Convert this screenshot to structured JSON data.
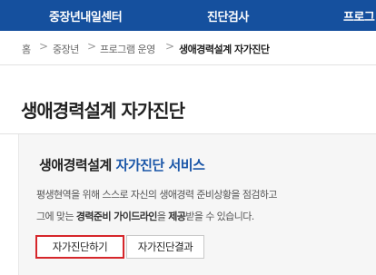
{
  "nav": {
    "items": [
      "중장년내일센터",
      "진단검사",
      "프로그"
    ]
  },
  "breadcrumb": {
    "home": "홈",
    "items": [
      "중장년",
      "프로그램 운영"
    ],
    "current": "생애경력설계 자가진단",
    "separator": ">"
  },
  "page": {
    "title": "생애경력설계 자가진단"
  },
  "service": {
    "title_main": "생애경력설계",
    "title_highlight": "자가진단 서비스",
    "desc_line1": "평생현역을 위해 스스로 자신의 생애경력 준비상황을 점검하고",
    "desc_line2_pre": "그에 맞는",
    "desc_line2_bold1": "경력준비 가이드라인",
    "desc_line2_mid": "을",
    "desc_line2_bold2": "제공",
    "desc_line2_post": "받을 수 있습니다."
  },
  "buttons": {
    "self_diagnosis": "자가진단하기",
    "self_diagnosis_result": "자가진단결과"
  },
  "colors": {
    "nav_bg": "#15509e",
    "highlight": "#1a56a8",
    "button_highlight_border": "#d6262b"
  }
}
